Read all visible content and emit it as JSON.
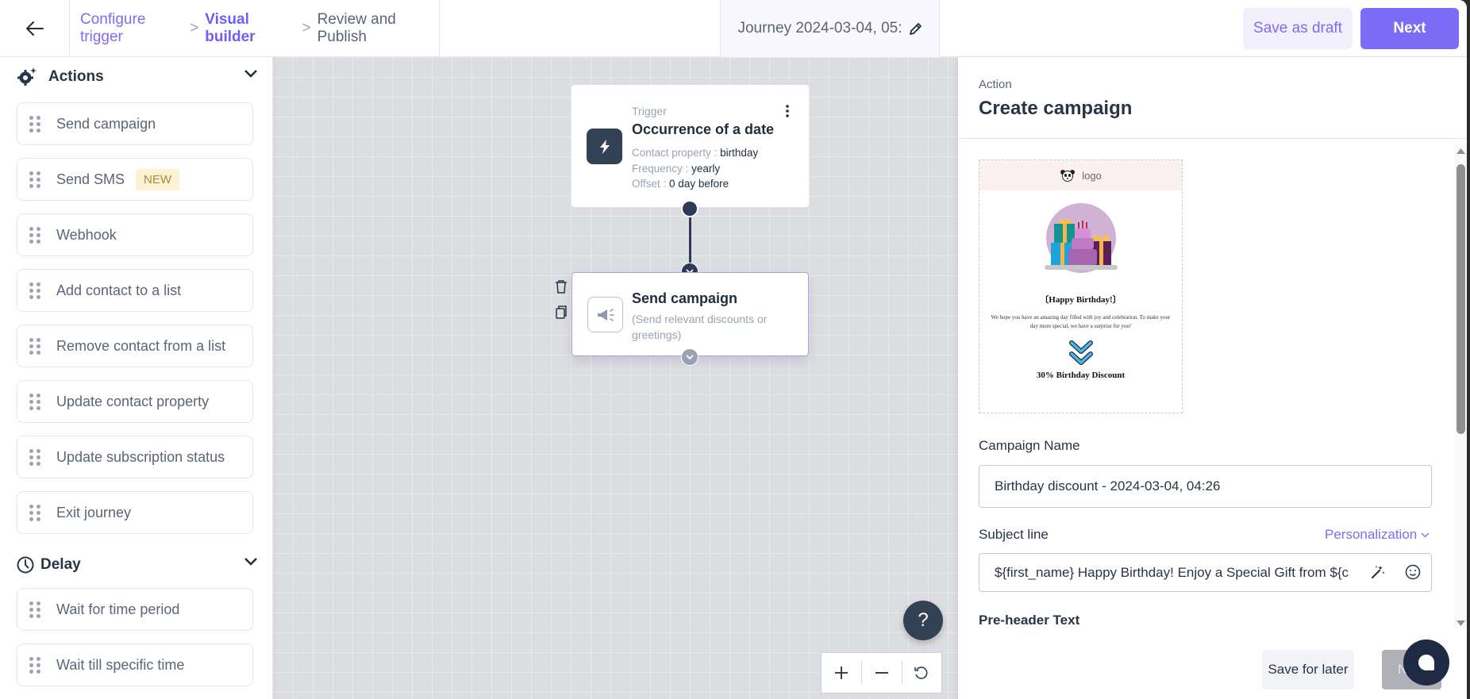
{
  "header": {
    "breadcrumb": [
      {
        "label": "Configure trigger",
        "state": "done"
      },
      {
        "label": "Visual builder",
        "state": "active"
      },
      {
        "label": "Review and Publish",
        "state": "pending"
      }
    ],
    "breadcrumb_separator": ">",
    "journey_title": "Journey 2024-03-04, 05:",
    "save_draft_label": "Save as draft",
    "next_label": "Next"
  },
  "sidebar": {
    "actions_heading": "Actions",
    "actions": [
      {
        "label": "Send campaign"
      },
      {
        "label": "Send SMS",
        "badge": "NEW"
      },
      {
        "label": "Webhook"
      },
      {
        "label": "Add contact to a list"
      },
      {
        "label": "Remove contact from a list"
      },
      {
        "label": "Update contact property"
      },
      {
        "label": "Update subscription status"
      },
      {
        "label": "Exit journey"
      }
    ],
    "delay_heading": "Delay",
    "delay": [
      {
        "label": "Wait for time period"
      },
      {
        "label": "Wait till specific time"
      }
    ]
  },
  "canvas": {
    "trigger": {
      "kicker": "Trigger",
      "title": "Occurrence of a date",
      "props": [
        {
          "key": "Contact property :",
          "value": "birthday"
        },
        {
          "key": "Frequency :",
          "value": "yearly"
        },
        {
          "key": "Offset :",
          "value": "0 day before"
        }
      ]
    },
    "campaign": {
      "title": "Send campaign",
      "description": "(Send relevant discounts or greetings)"
    },
    "help_label": "?"
  },
  "panel": {
    "kicker": "Action",
    "title": "Create campaign",
    "preview": {
      "logo_text": "logo",
      "heading": "〔Happy Birthday!〕",
      "body": "We hope you have an amazing day filled with joy and celebration. To make your day more special, we have a surprise for you!",
      "discount": "30% Birthday Discount"
    },
    "campaign_name_label": "Campaign Name",
    "campaign_name_value": "Birthday discount - 2024-03-04, 04:26",
    "subject_label": "Subject line",
    "personalization_label": "Personalization",
    "subject_value": "${first_name} Happy Birthday! Enjoy a Special Gift from ${c",
    "preheader_label": "Pre-header Text",
    "save_later_label": "Save for later",
    "next_label": "N"
  },
  "colors": {
    "accent": "#7b6cf6",
    "dark": "#334154",
    "canvas_bg": "#dcdde1"
  }
}
